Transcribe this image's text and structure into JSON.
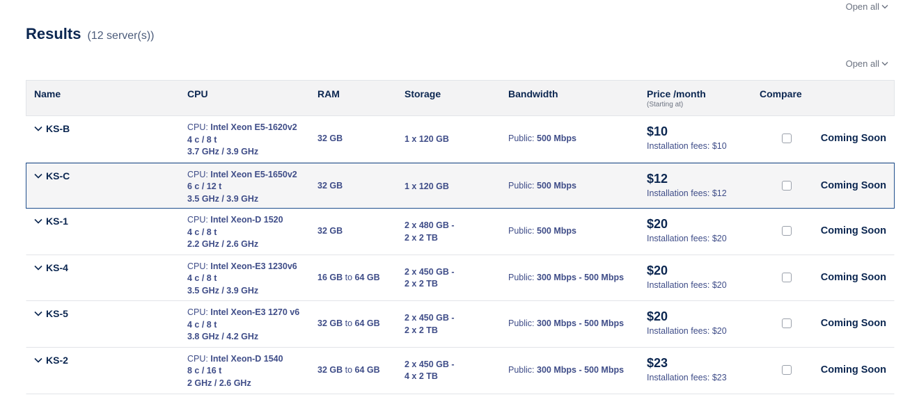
{
  "page": {
    "open_all_label": "Open all",
    "results_title": "Results",
    "results_count": "(12 server(s))"
  },
  "table": {
    "headers": {
      "name": "Name",
      "cpu": "CPU",
      "ram": "RAM",
      "storage": "Storage",
      "bandwidth": "Bandwidth",
      "price": "Price /month",
      "price_sub": "(Starting at)",
      "compare": "Compare"
    },
    "cpu_prefix": "CPU:",
    "ram_to": "to",
    "bandwidth_prefix": "Public:",
    "fees_prefix": "Installation fees:",
    "rows": [
      {
        "name": "KS-B",
        "cpu_model": "Intel Xeon E5-1620v2",
        "cores": "4 c / 8 t",
        "freq": "3.7 GHz / 3.9 GHz",
        "ram_min": "32 GB",
        "ram_max": "",
        "storage1": "1 x 120 GB",
        "storage2": "",
        "bandwidth": "500 Mbps",
        "price": "$10",
        "fees": "$10",
        "status": "Coming Soon",
        "selected": false
      },
      {
        "name": "KS-C",
        "cpu_model": "Intel Xeon E5-1650v2",
        "cores": "6 c / 12 t",
        "freq": "3.5 GHz / 3.9 GHz",
        "ram_min": "32 GB",
        "ram_max": "",
        "storage1": "1 x 120 GB",
        "storage2": "",
        "bandwidth": "500 Mbps",
        "price": "$12",
        "fees": "$12",
        "status": "Coming Soon",
        "selected": true
      },
      {
        "name": "KS-1",
        "cpu_model": "Intel Xeon-D 1520",
        "cores": "4 c / 8 t",
        "freq": "2.2 GHz / 2.6 GHz",
        "ram_min": "32 GB",
        "ram_max": "",
        "storage1": "2 x 480 GB -",
        "storage2": "2 x 2 TB",
        "bandwidth": "500 Mbps",
        "price": "$20",
        "fees": "$20",
        "status": "Coming Soon",
        "selected": false
      },
      {
        "name": "KS-4",
        "cpu_model": "Intel Xeon-E3 1230v6",
        "cores": "4 c / 8 t",
        "freq": "3.5 GHz / 3.9 GHz",
        "ram_min": "16 GB",
        "ram_max": "64 GB",
        "storage1": "2 x 450 GB -",
        "storage2": "2 x 2 TB",
        "bandwidth": "300 Mbps - 500 Mbps",
        "price": "$20",
        "fees": "$20",
        "status": "Coming Soon",
        "selected": false
      },
      {
        "name": "KS-5",
        "cpu_model": "Intel Xeon-E3 1270 v6",
        "cores": "4 c / 8 t",
        "freq": "3.8 GHz / 4.2 GHz",
        "ram_min": "32 GB",
        "ram_max": "64 GB",
        "storage1": "2 x 450 GB -",
        "storage2": "2 x 2 TB",
        "bandwidth": "300 Mbps - 500 Mbps",
        "price": "$20",
        "fees": "$20",
        "status": "Coming Soon",
        "selected": false
      },
      {
        "name": "KS-2",
        "cpu_model": "Intel Xeon-D 1540",
        "cores": "8 c / 16 t",
        "freq": "2 GHz / 2.6 GHz",
        "ram_min": "32 GB",
        "ram_max": "64 GB",
        "storage1": "2 x 450 GB -",
        "storage2": "4 x 2 TB",
        "bandwidth": "300 Mbps - 500 Mbps",
        "price": "$23",
        "fees": "$23",
        "status": "Coming Soon",
        "selected": false
      }
    ]
  }
}
